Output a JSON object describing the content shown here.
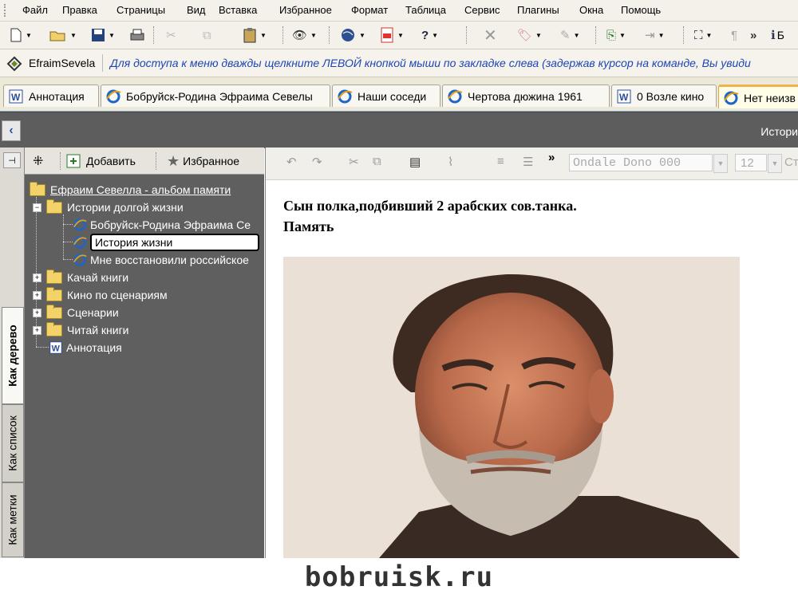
{
  "menu": [
    "Файл",
    "Правка",
    "Страницы",
    "Вид",
    "Вставка",
    "Избранное",
    "Формат",
    "Таблица",
    "Сервис",
    "Плагины",
    "Окна",
    "Помощь"
  ],
  "toolbar": {
    "overflow": "»",
    "trailing_letter": "Б"
  },
  "address": {
    "name": "EfraimSevela",
    "hint": "Для доступа к меню дважды щелкните ЛЕВОЙ кнопкой мыши по закладке слева (задержав курсор на команде, Вы увиди"
  },
  "tabs": [
    "Аннотация",
    "Бобруйск-Родина Эфраима Севелы",
    "Наши соседи",
    "Чертова дюжина 1961",
    "0 Возле кино",
    "Нет неизв"
  ],
  "band": {
    "title": "Истори"
  },
  "vtabs": [
    "Как дерево",
    "Как список",
    "Как метки"
  ],
  "tree_toolbar": {
    "add": "Добавить",
    "favorites": "Избранное"
  },
  "tree": {
    "root": "Ефраим Севелла  - альбом памяти",
    "group": "Истории долгой жизни",
    "children": [
      "Бобруйск-Родина Эфраима Се",
      "История жизни",
      "Мне восстановили российское"
    ],
    "folders": [
      "Качай книги",
      "Кино по сценариям",
      "Сценарии",
      "Читай книги"
    ],
    "annotation": "Аннотация"
  },
  "editor": {
    "font": "Ondale Dono 000",
    "size": "12",
    "style": "Ст",
    "overflow": "»"
  },
  "content": {
    "line1": "Сын полка,подбивший 2 арабских сов.танка.",
    "line2": "Память"
  },
  "watermark": "bobruisk.ru"
}
